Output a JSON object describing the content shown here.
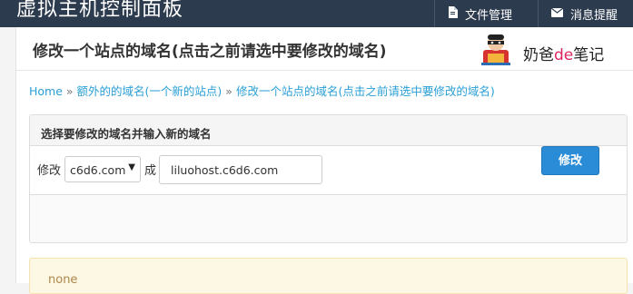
{
  "header": {
    "brand": "虚拟主机控制面板",
    "nav": [
      {
        "label": "文件管理",
        "icon": "file-icon"
      },
      {
        "label": "消息提醒",
        "icon": "mail-icon"
      }
    ]
  },
  "main": {
    "title": "修改一个站点的域名(点击之前请选中要修改的域名)",
    "logo": {
      "text_a": "奶爸",
      "text_b": "de",
      "text_c": "笔记"
    },
    "breadcrumb": {
      "home": "Home",
      "sep": "»",
      "level1": "额外的的域名(一个新的站点)",
      "level2": "修改一个站点的域名(点击之前请选中要修改的域名)"
    },
    "panel": {
      "heading": "选择要修改的域名并输入新的域名",
      "modify_label": "修改",
      "selected_domain": "c6d6.com",
      "to_label": "成",
      "new_domain": "liluohost.c6d6.com",
      "submit_label": "修改"
    },
    "notice": "none"
  },
  "colors": {
    "topbar": "#2d3b4e",
    "link": "#2a9fd6",
    "primary_button": "#2a8bd6",
    "notice_bg": "#fcf8e3"
  }
}
